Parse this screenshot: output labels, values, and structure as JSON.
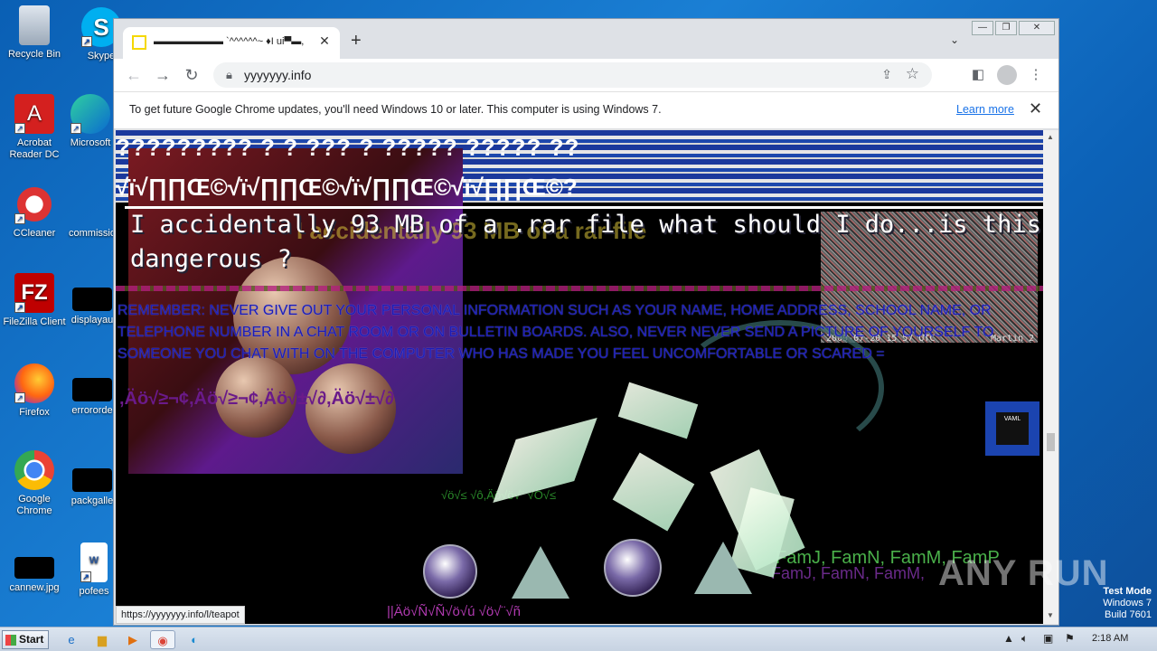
{
  "desktop": {
    "icons": [
      {
        "label": "Recycle Bin"
      },
      {
        "label": "Skype"
      },
      {
        "label": "Acrobat Reader DC"
      },
      {
        "label": "Microsoft"
      },
      {
        "label": "CCleaner"
      },
      {
        "label": "commissio"
      },
      {
        "label": "FileZilla Client"
      },
      {
        "label": "displayau"
      },
      {
        "label": "Firefox"
      },
      {
        "label": "errororde"
      },
      {
        "label": "Google Chrome"
      },
      {
        "label": "packgalle"
      },
      {
        "label": "cannew.jpg"
      },
      {
        "label": "pofees"
      }
    ]
  },
  "browser": {
    "tab": {
      "title": "▬▬▬▬▬▬▬ `^^^^^^~ ♦I ui▀▬,"
    },
    "new_tab": "+",
    "tab_menu": "⌄",
    "address": {
      "url": "yyyyyyy.info"
    },
    "infobar": {
      "message": "To get future Google Chrome updates, you'll need Windows 10 or later. This computer is using Windows 7.",
      "link": "Learn more"
    },
    "status_url": "https://yyyyyyy.info/l/teapot"
  },
  "page": {
    "line1": "????????? ? ? ??? ? ????? ????? ??",
    "line2": "√ï√∏∏Œ©√ï√∏∏Œ©√ï√∏∏Œ©√ï√∏∏Œ©?",
    "headline": "I accidentally 93 MB of a .rar file what should I do...is this dangerous ?",
    "ghost_text": "I accidentally 93 MB of a rar file",
    "remember": "REMEMBER: NEVER GIVE OUT YOUR PERSONAL INFORMATION SUCH AS YOUR NAME, HOME ADDRESS, SCHOOL NAME, OR TELEPHONE NUMBER IN A CHAT ROOM OR ON BULLETIN BOARDS. ALSO, NEVER NEVER SEND A PICTURE OF YOURSELF TO SOMEONE YOU CHAT WITH ON THE COMPUTER WHO HAS MADE YOU FEEL UNCOMFORTABLE OR SCARED =",
    "garble": ",Äö√≥¬¢,Äö√≥¬¢,Äö√±√∂,Äö√±√∂",
    "garble_small": "√ö√≤ √ô,Äö√ö√¨ √Ö√≤",
    "garble_bottom": "||Äö√Ñ√Ñ√ö√ú   √ö√¨√ñ",
    "fam": "FamJ, FamN, FamM, FamP",
    "fam_ghost": "FamJ, FamN, FamM,",
    "noise_stamp": "2009-07-20 15 57 UTC",
    "noise_label": "Martin 2",
    "vaml_label": "VAML"
  },
  "watermark": "ANY RUN",
  "system": {
    "test_mode": "Test Mode",
    "os": "Windows 7",
    "build": "Build 7601",
    "start": "Start",
    "time": "2:18 AM"
  }
}
